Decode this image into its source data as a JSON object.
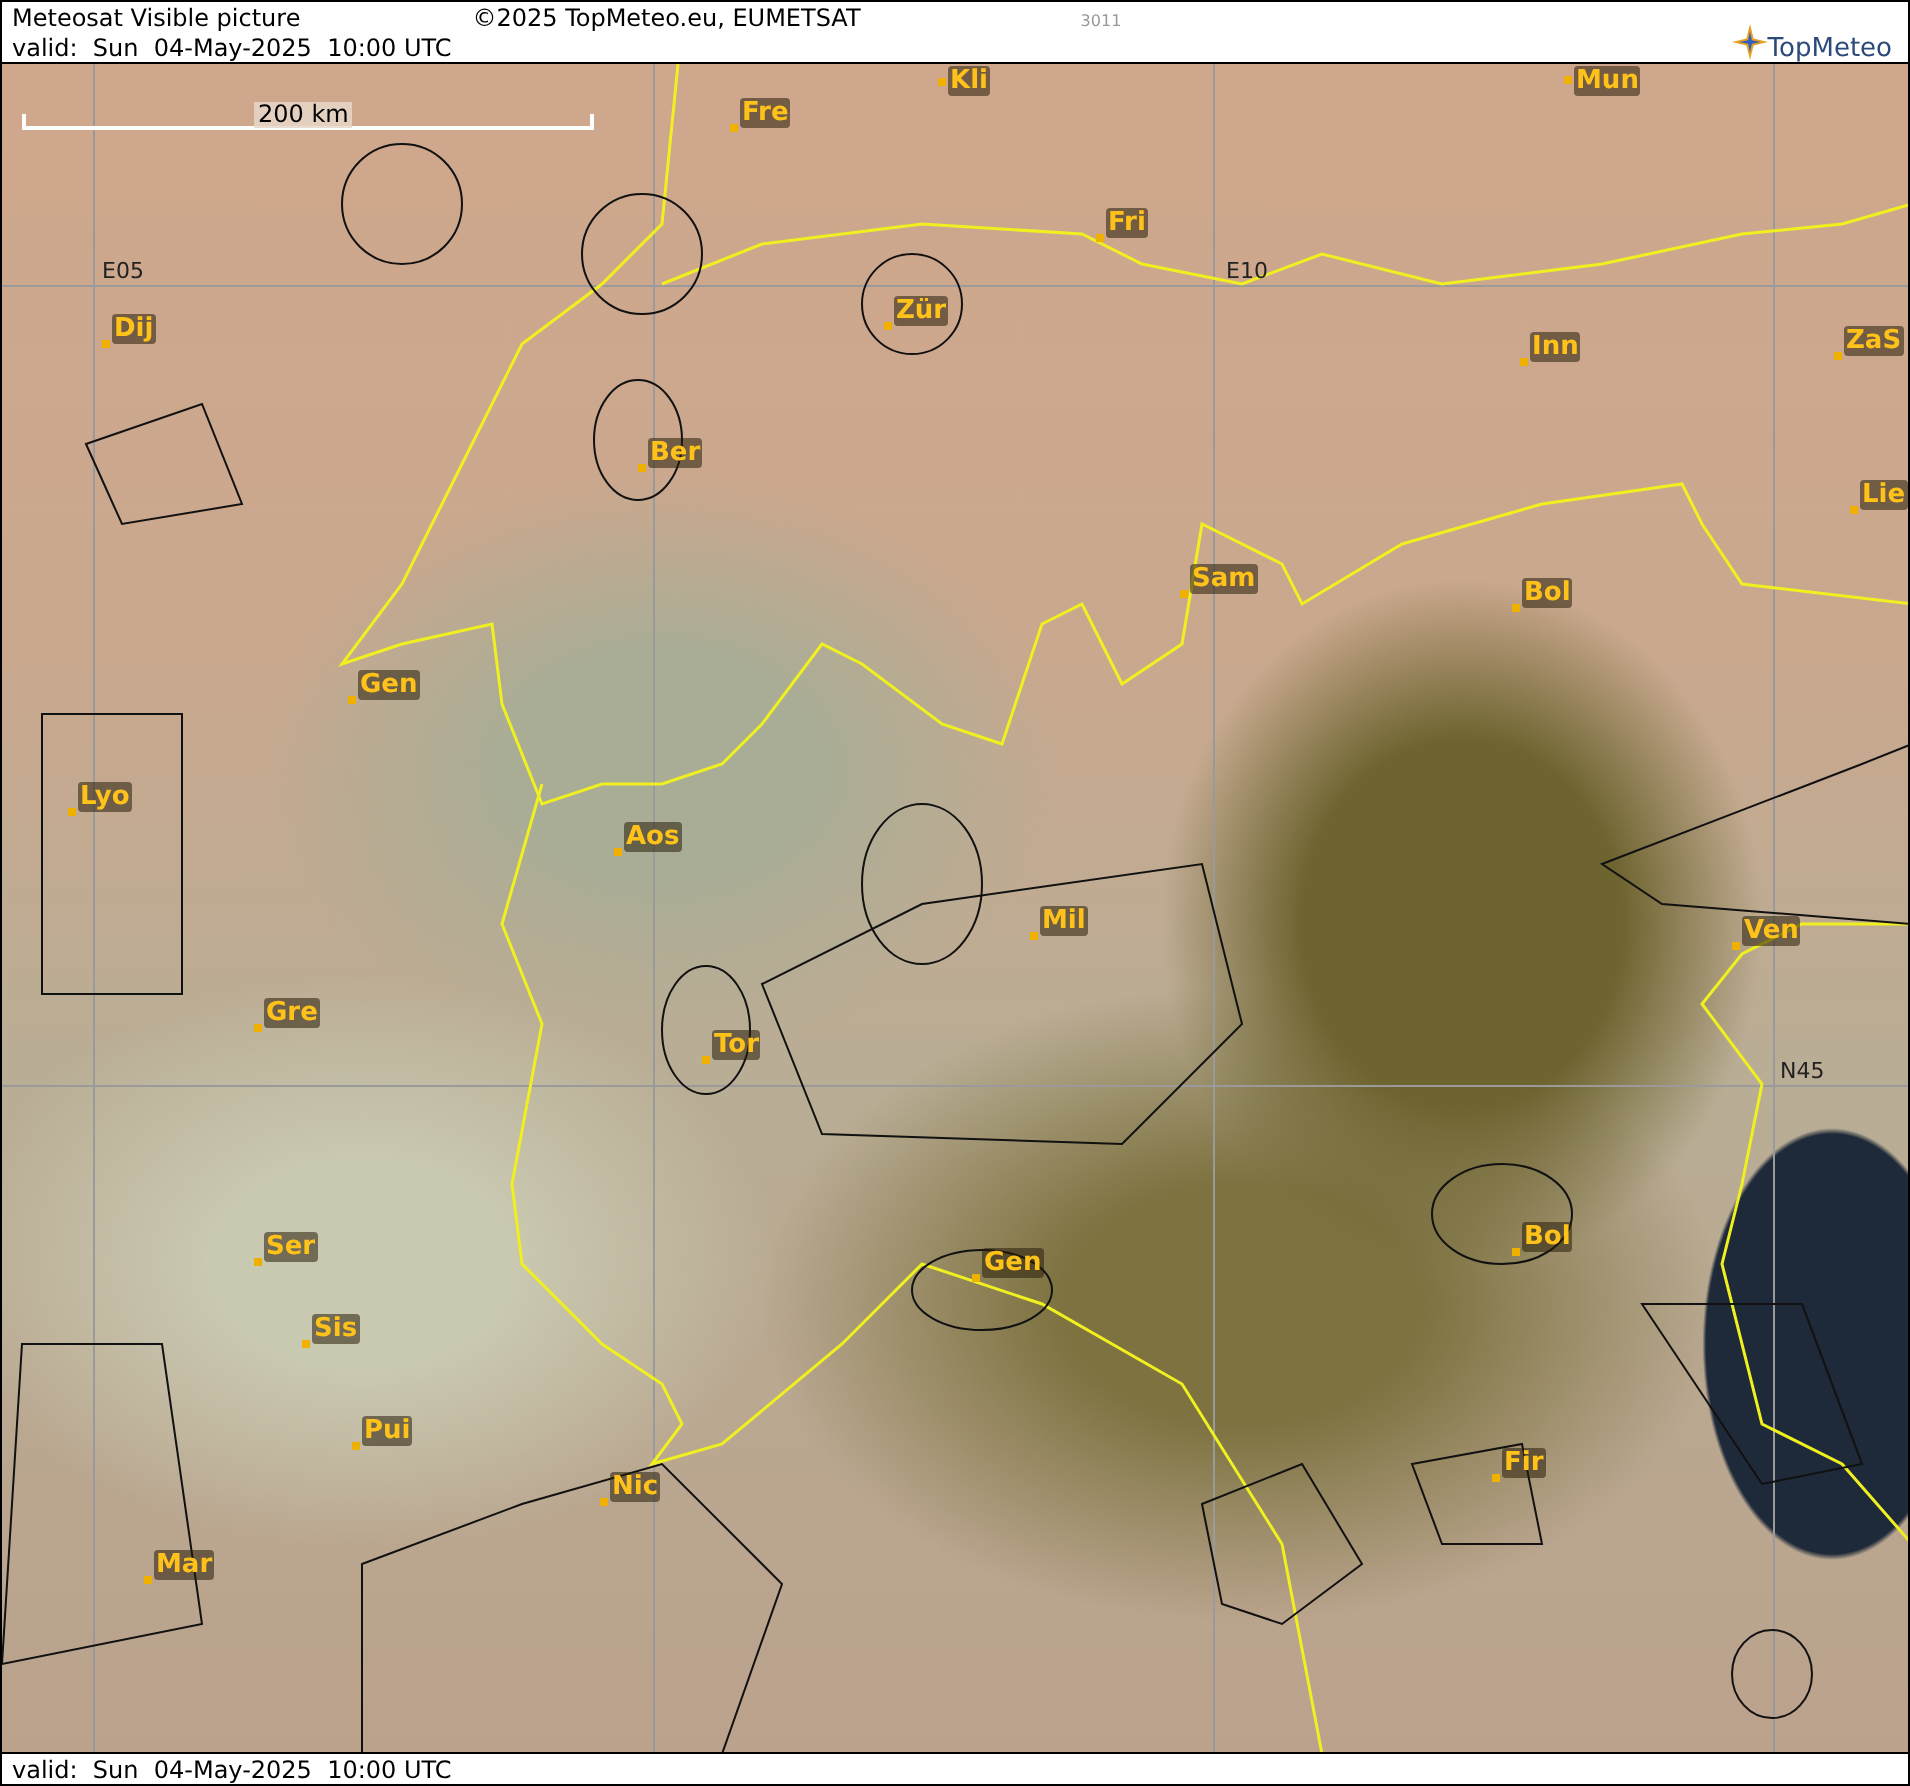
{
  "header": {
    "title": "Meteosat Visible picture",
    "copyright": "©2025 TopMeteo.eu, EUMETSAT",
    "code": "3011",
    "valid": "valid:  Sun  04-May-2025  10:00 UTC",
    "logo": "TopMeteo"
  },
  "map": {
    "scale": "200 km",
    "grid_labels": [
      "E05",
      "E10",
      "N45"
    ],
    "cities": [
      {
        "name": "Kli"
      },
      {
        "name": "Mun"
      },
      {
        "name": "Fre"
      },
      {
        "name": "Fri"
      },
      {
        "name": "Dij"
      },
      {
        "name": "Zür"
      },
      {
        "name": "Inn"
      },
      {
        "name": "ZaS"
      },
      {
        "name": "Ber"
      },
      {
        "name": "Lie"
      },
      {
        "name": "Sam"
      },
      {
        "name": "Bol"
      },
      {
        "name": "Gen"
      },
      {
        "name": "Lyo"
      },
      {
        "name": "Aos"
      },
      {
        "name": "Mil"
      },
      {
        "name": "Ven"
      },
      {
        "name": "Gre"
      },
      {
        "name": "Tor"
      },
      {
        "name": "Ser"
      },
      {
        "name": "Bol"
      },
      {
        "name": "Gen"
      },
      {
        "name": "Sis"
      },
      {
        "name": "Pui"
      },
      {
        "name": "Fir"
      },
      {
        "name": "Nic"
      },
      {
        "name": "Mar"
      }
    ]
  },
  "footer": {
    "valid": "valid:  Sun  04-May-2025  10:00 UTC"
  }
}
